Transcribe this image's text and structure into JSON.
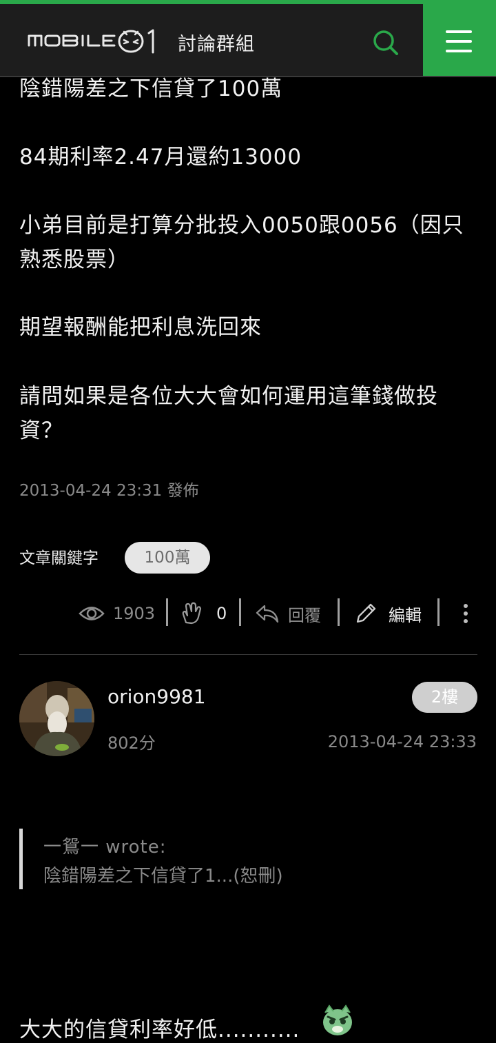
{
  "header": {
    "logo_text": "MOBILE01",
    "title": "討論群組",
    "colors": {
      "accent": "#2aa84a",
      "bar": "#1d1d1d"
    }
  },
  "post": {
    "paragraphs": [
      "陰錯陽差之下信貸了100萬",
      "84期利率2.47月還約13000",
      "小弟目前是打算分批投入0050跟0056（因只熟悉股票）",
      "期望報酬能把利息洗回來",
      "請問如果是各位大大會如何運用這筆錢做投資？"
    ],
    "posted_time": "2013-04-24 23:31 發佈",
    "keywords_label": "文章關鍵字",
    "keywords": [
      "100萬"
    ],
    "actions": {
      "views": "1903",
      "likes": "0",
      "reply_label": "回覆",
      "edit_label": "編輯"
    }
  },
  "reply": {
    "username": "orion9981",
    "score": "802分",
    "floor": "2樓",
    "time": "2013-04-24 23:33",
    "quote_author": "一鴛一 wrote:",
    "quote_text": "陰錯陽差之下信貸了1...(恕刪)",
    "text": "大大的信貸利率好低..........."
  }
}
